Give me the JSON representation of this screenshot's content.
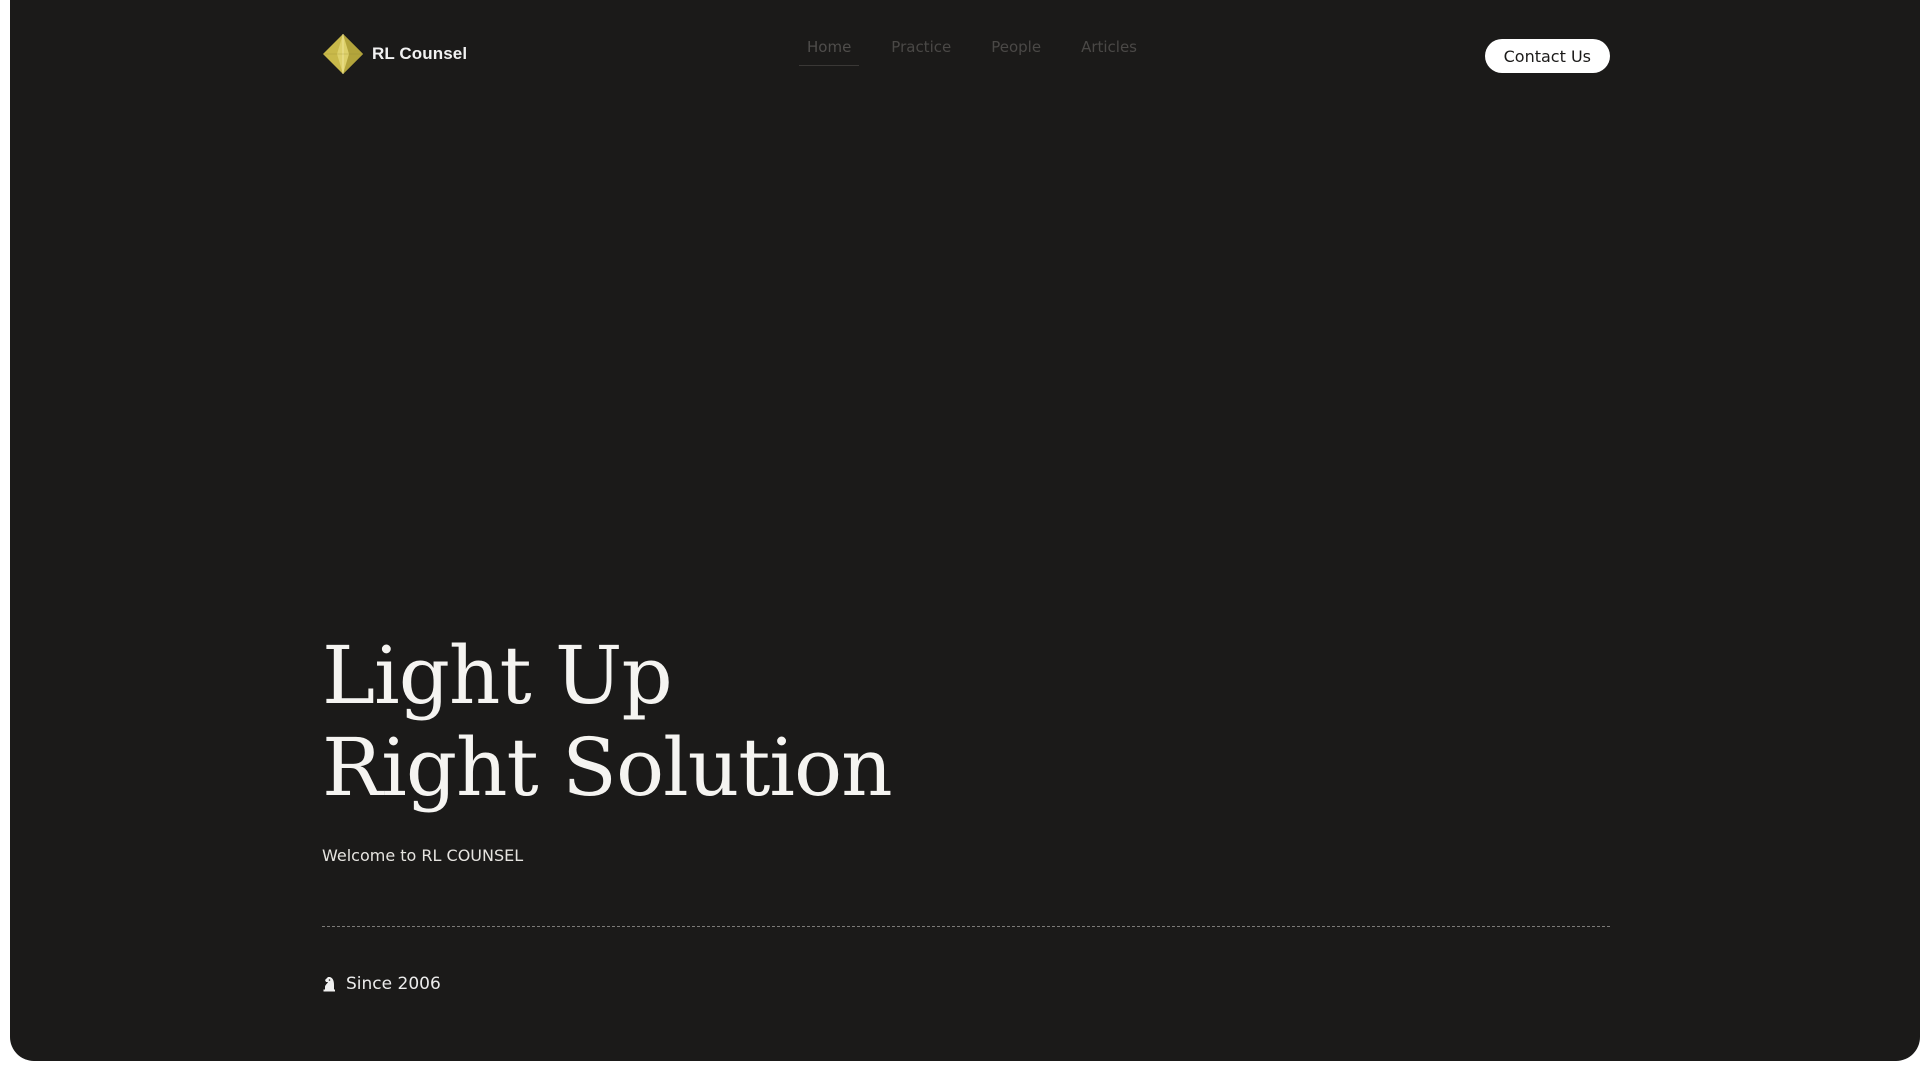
{
  "brand": {
    "name": "RL Counsel",
    "logo_icon": "diamond-logo-icon",
    "logo_color": "#c9b94a"
  },
  "nav": {
    "items": [
      {
        "label": "Home",
        "active": true
      },
      {
        "label": "Practice",
        "active": false
      },
      {
        "label": "People",
        "active": false
      },
      {
        "label": "Articles",
        "active": false
      }
    ]
  },
  "header": {
    "contact_label": "Contact Us"
  },
  "hero": {
    "title_line1": "Light Up",
    "title_line2": "Right Solution",
    "subtitle": "Welcome to RL COUNSEL"
  },
  "footer_note": {
    "icon": "chess-knight-icon",
    "text": "Since 2006"
  },
  "colors": {
    "background": "#1b1a19",
    "text": "#f5f4f1",
    "accent": "#c9b94a"
  }
}
